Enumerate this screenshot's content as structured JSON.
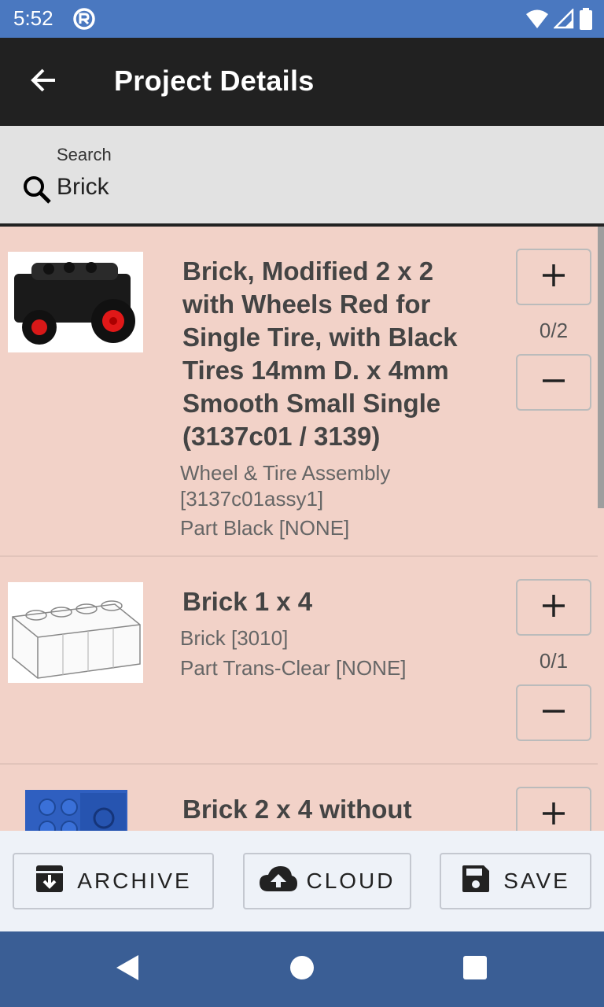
{
  "status_bar": {
    "time": "5:52"
  },
  "app_bar": {
    "title": "Project Details"
  },
  "search": {
    "label": "Search",
    "value": "Brick"
  },
  "items": [
    {
      "title": "Brick, Modified 2 x 2 with Wheels Red for Single Tire, with Black Tires 14mm D. x 4mm Smooth Small Single (3137c01 / 3139)",
      "subtitle_1": "Wheel & Tire Assembly [3137c01assy1]",
      "subtitle_2": "Part Black [NONE]",
      "count": "0/2"
    },
    {
      "title": "Brick 1 x 4",
      "subtitle_1": "Brick [3010]",
      "subtitle_2": "Part Trans-Clear [NONE]",
      "count": "0/1"
    },
    {
      "title": "Brick 2 x 4 without"
    }
  ],
  "actions": {
    "archive": "ARCHIVE",
    "cloud": "CLOUD",
    "save": "SAVE"
  },
  "colors": {
    "status_bar": "#4a78c0",
    "app_bar": "#212121",
    "list_bg": "#f2d2c8",
    "nav_bar": "#3a5e95"
  }
}
